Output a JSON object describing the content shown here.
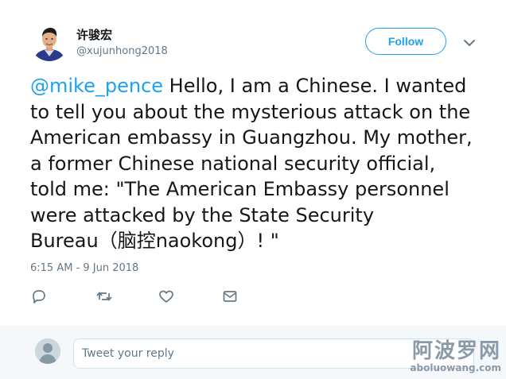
{
  "author": {
    "display_name": "许骏宏",
    "handle": "@xujunhong2018"
  },
  "header": {
    "follow_label": "Follow",
    "more_icon": "chevron-down-icon"
  },
  "tweet": {
    "mention": "@mike_pence",
    "text": " Hello, I am a Chinese. I wanted\nto tell you about the mysterious attack on the\nAmerican embassy in Guangzhou. My mother,\na former Chinese national security official,\ntold me: \"The American Embassy personnel\nwere attacked by the State Security\nBureau（脑控naokong）! \"",
    "timestamp": "6:15 AM - 9 Jun 2018"
  },
  "actions": {
    "icons": [
      "reply-icon",
      "retweet-icon",
      "like-icon",
      "message-icon"
    ]
  },
  "reply": {
    "placeholder": "Tweet your reply"
  },
  "watermark": {
    "chinese": "阿波罗网",
    "url": "aboluowang.com"
  },
  "colors": {
    "accent": "#1da1f2",
    "secondary_text": "#657786",
    "reply_bar_bg": "#f5f8fa"
  }
}
